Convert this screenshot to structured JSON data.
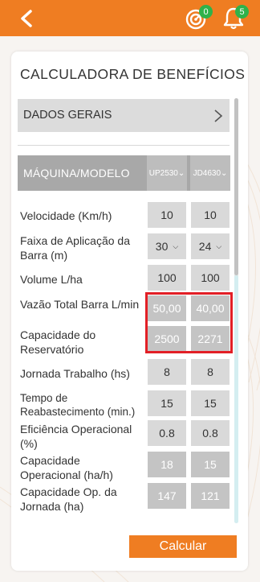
{
  "header": {
    "back_icon": "chevron-left-icon",
    "points_badge": "0",
    "notifications_badge": "5",
    "colors": {
      "bar": "#ef7d22",
      "badge": "#2fb24a"
    }
  },
  "card": {
    "title": "CALCULADORA DE BENEFÍCIOS"
  },
  "general_section": {
    "label": "DADOS GERAIS"
  },
  "table": {
    "header_label": "MÁQUINA/MODELO",
    "machine_a": "UP2530",
    "machine_b": "JD4630",
    "rows": [
      {
        "label": "Velocidade (Km/h)",
        "a": "10",
        "b": "10"
      },
      {
        "label": "Faixa de Aplicação da Barra (m)",
        "a": "30",
        "b": "24"
      },
      {
        "label": "Volume L/ha",
        "a": "100",
        "b": "100"
      },
      {
        "label": "Vazão Total Barra L/min",
        "a": "50,00",
        "b": "40,00"
      },
      {
        "label": "Capacidade do Reservatório",
        "a": "2500",
        "b": "2271"
      },
      {
        "label": "Jornada Trabalho (hs)",
        "a": "8",
        "b": "8"
      },
      {
        "label": "Tempo de Reabastecimento (min.)",
        "a": "15",
        "b": "15"
      },
      {
        "label": "Eficiência Operacional (%)",
        "a": "0.8",
        "b": "0.8"
      },
      {
        "label": "Capacidade Operacional (ha/h)",
        "a": "18",
        "b": "15"
      },
      {
        "label": "Capacidade Op. da Jornada (ha)",
        "a": "147",
        "b": "121"
      }
    ]
  },
  "calc_button": "Calcular",
  "highlight_color": "#e21f26"
}
